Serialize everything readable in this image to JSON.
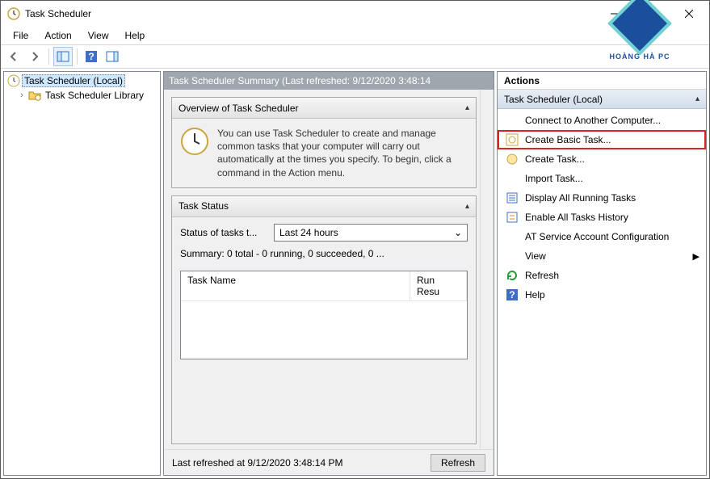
{
  "window": {
    "title": "Task Scheduler"
  },
  "menu": {
    "file": "File",
    "action": "Action",
    "view": "View",
    "help": "Help"
  },
  "tree": {
    "root": "Task Scheduler (Local)",
    "lib": "Task Scheduler Library"
  },
  "center": {
    "header": "Task Scheduler Summary (Last refreshed: 9/12/2020 3:48:14",
    "overview_title": "Overview of Task Scheduler",
    "overview_text": "You can use Task Scheduler to create and manage common tasks that your computer will carry out automatically at the times you specify. To begin, click a command in the Action menu.",
    "status_title": "Task Status",
    "status_label": "Status of tasks t...",
    "status_combo": "Last 24 hours",
    "summary": "Summary: 0 total - 0 running, 0 succeeded, 0 ...",
    "col_name": "Task Name",
    "col_result": "Run Resu",
    "footer_text": "Last refreshed at 9/12/2020 3:48:14 PM",
    "refresh_btn": "Refresh"
  },
  "actions": {
    "header": "Actions",
    "group": "Task Scheduler (Local)",
    "items": {
      "connect": "Connect to Another Computer...",
      "create_basic": "Create Basic Task...",
      "create_task": "Create Task...",
      "import": "Import Task...",
      "display_running": "Display All Running Tasks",
      "enable_history": "Enable All Tasks History",
      "at_config": "AT Service Account Configuration",
      "view": "View",
      "refresh": "Refresh",
      "help": "Help"
    }
  },
  "watermark": {
    "brand": "HOÀNG HÀ PC"
  }
}
